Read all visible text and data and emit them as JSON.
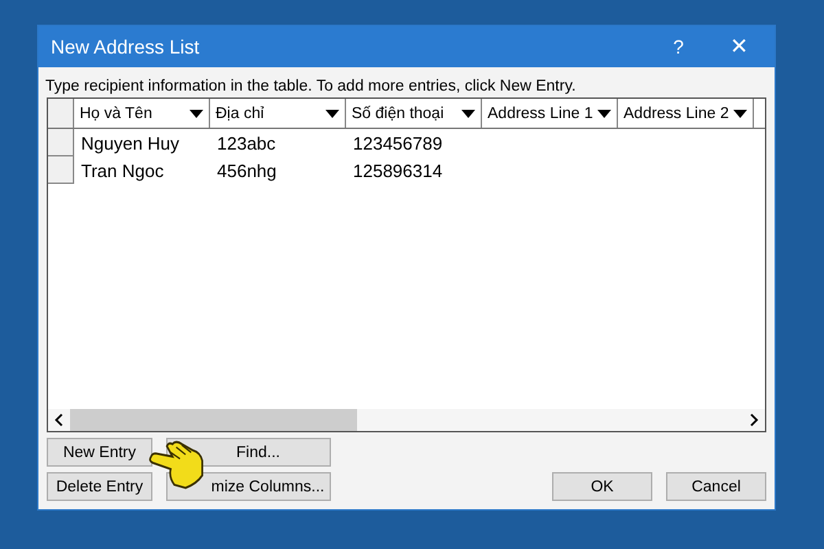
{
  "window": {
    "title": "New Address List",
    "help": "?",
    "close": "✕"
  },
  "instruction": "Type recipient information in the table.  To add more entries, click New Entry.",
  "table": {
    "columns": [
      "Họ và Tên",
      "Địa chỉ",
      "Số điện thoại",
      "Address Line 1",
      "Address Line 2"
    ],
    "rows": [
      [
        "Nguyen Huy",
        "123abc",
        "123456789",
        "",
        ""
      ],
      [
        "Tran Ngoc",
        "456nhg",
        "125896314",
        "",
        ""
      ]
    ]
  },
  "buttons_left": [
    [
      "New Entry",
      "Find..."
    ],
    [
      "Delete Entry",
      "mize Columns..."
    ]
  ],
  "buttons_right": [
    "OK",
    "Cancel"
  ]
}
